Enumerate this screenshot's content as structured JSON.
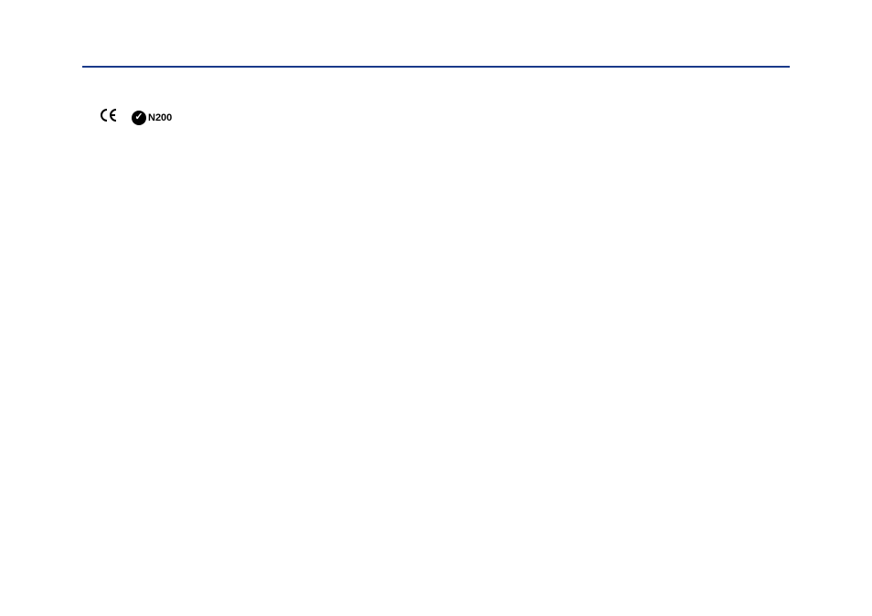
{
  "marks": {
    "ce": "CE",
    "ctick_number": "N200"
  }
}
